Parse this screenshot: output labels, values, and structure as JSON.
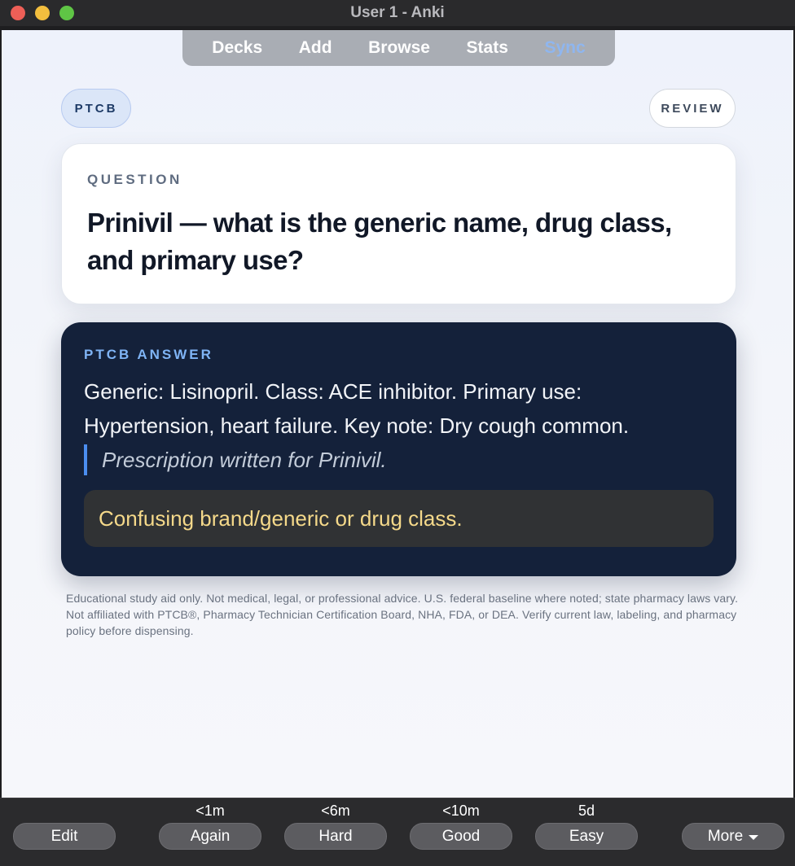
{
  "window": {
    "title": "User 1 - Anki"
  },
  "nav": {
    "decks": "Decks",
    "add": "Add",
    "browse": "Browse",
    "stats": "Stats",
    "sync": "Sync"
  },
  "deck_pill": "PTCB",
  "review_pill": "REVIEW",
  "question": {
    "label": "QUESTION",
    "text": "Prinivil — what is the generic name, drug class, and primary use?"
  },
  "answer": {
    "label": "PTCB ANSWER",
    "text": "Generic: Lisinopril. Class: ACE inhibitor. Primary use: Hypertension, heart failure. Key note: Dry cough common.",
    "quote": "Prescription written for Prinivil.",
    "warning": "Confusing brand/generic or drug class."
  },
  "disclaimer": "Educational study aid only. Not medical, legal, or professional advice. U.S. federal baseline where noted; state pharmacy laws vary. Not affiliated with PTCB®, Pharmacy Technician Certification Board, NHA, FDA, or DEA. Verify current law, labeling, and pharmacy policy before dispensing.",
  "bottom": {
    "edit": "Edit",
    "again": {
      "label": "Again",
      "time": "<1m"
    },
    "hard": {
      "label": "Hard",
      "time": "<6m"
    },
    "good": {
      "label": "Good",
      "time": "<10m"
    },
    "easy": {
      "label": "Easy",
      "time": "5d"
    },
    "more": "More"
  },
  "colors": {
    "answer_bg": "#14213a",
    "answer_label": "#7fb4f5",
    "warning_text": "#f5d98a",
    "quote_bar": "#4b8ef0",
    "sync": "#8fb6ef"
  }
}
